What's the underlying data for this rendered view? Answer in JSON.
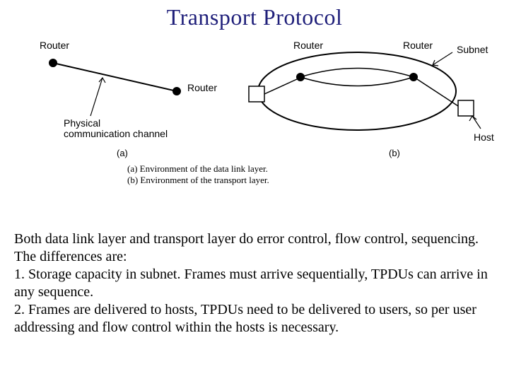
{
  "title": "Transport Protocol",
  "labels": {
    "router_a": "Router",
    "router_b": "Router",
    "subnet": "Subnet",
    "host": "Host",
    "phys_line1": "Physical",
    "phys_line2": "communication channel",
    "marker_a": "(a)",
    "marker_b": "(b)"
  },
  "caption": {
    "line1": "(a) Environment of the data link layer.",
    "line2": "(b) Environment of the transport layer."
  },
  "body": {
    "p1": "Both data link layer and transport layer do error control, flow control, sequencing. The differences are:",
    "p2": "1. Storage capacity in subnet. Frames must arrive sequentially, TPDUs can arrive in any sequence.",
    "p3": "2. Frames are delivered to hosts, TPDUs need to be delivered to users, so per user addressing and  flow control within the hosts is necessary."
  }
}
